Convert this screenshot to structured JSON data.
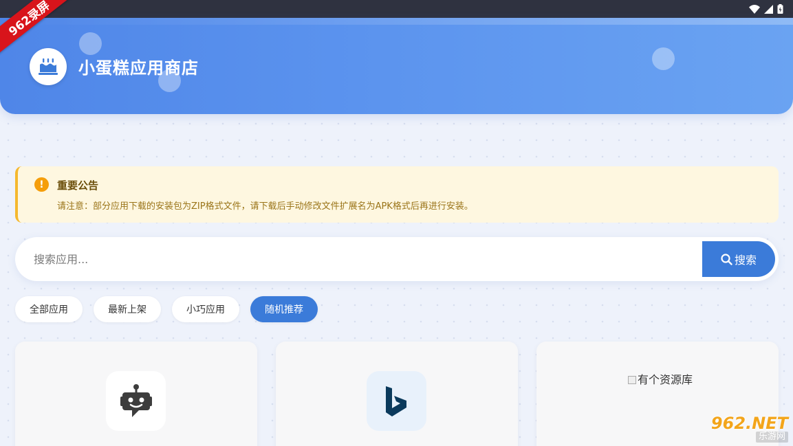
{
  "badge": {
    "text": "962录屏"
  },
  "header": {
    "title": "小蛋糕应用商店"
  },
  "notice": {
    "title": "重要公告",
    "icon_glyph": "!",
    "text": "请注意：部分应用下载的安装包为ZIP格式文件，请下载后手动修改文件扩展名为APK格式后再进行安装。"
  },
  "search": {
    "placeholder": "搜索应用...",
    "value": "",
    "button_label": "搜索"
  },
  "tabs": [
    {
      "label": "全部应用",
      "active": false
    },
    {
      "label": "最新上架",
      "active": false
    },
    {
      "label": "小巧应用",
      "active": false
    },
    {
      "label": "随机推荐",
      "active": true
    }
  ],
  "cards": [
    {
      "icon": "robot-icon"
    },
    {
      "icon": "bing-icon"
    },
    {
      "broken_image_alt": "有个资源库"
    }
  ],
  "watermark": {
    "main": "962.NET",
    "sub": "乐游网"
  },
  "colors": {
    "accent": "#3b7bd9",
    "header": "#5b93ee",
    "notice_bg": "#fef7e0",
    "notice_border": "#f5b82e"
  }
}
